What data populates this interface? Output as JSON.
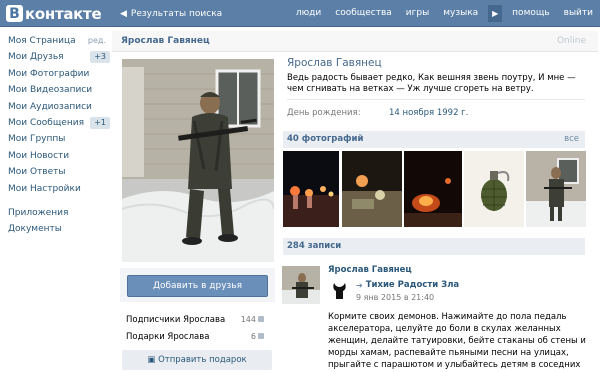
{
  "header": {
    "logo_letter": "В",
    "logo_text": "контакте",
    "back_label": "Результаты поиска",
    "nav": [
      "люди",
      "сообщества",
      "игры",
      "музыка",
      "помощь",
      "выйти"
    ]
  },
  "menu": {
    "items": [
      {
        "label": "Моя Страница",
        "extra": "ред."
      },
      {
        "label": "Мои Друзья",
        "badge": "+3"
      },
      {
        "label": "Мои Фотографии"
      },
      {
        "label": "Мои Видеозаписи"
      },
      {
        "label": "Мои Аудиозаписи"
      },
      {
        "label": "Мои Сообщения",
        "badge": "+1"
      },
      {
        "label": "Мои Группы"
      },
      {
        "label": "Мои Новости"
      },
      {
        "label": "Мои Ответы"
      },
      {
        "label": "Мои Настройки"
      }
    ],
    "secondary": [
      "Приложения",
      "Документы"
    ]
  },
  "profile": {
    "bar_name": "Ярослав Гавянец",
    "online": "Online",
    "name": "Ярослав Гавянец",
    "status": "Ведь радость бывает редко, Как вешняя звень поутру, И мне — чем сгнивать на ветках — Уж лучше сгореть на ветру.",
    "bday_label": "День рождения:",
    "bday_value": "14 ноября 1992 г.",
    "add_friend": "Добавить в друзья",
    "subscribers_label": "Подписчики Ярослава",
    "subscribers_count": "144",
    "gifts_label": "Подарки Ярослава",
    "gifts_count": "6",
    "send_gift": "Отправить подарок"
  },
  "photos": {
    "title": "40 фотографий",
    "all": "все"
  },
  "wall": {
    "title": "284 записи",
    "author": "Ярослав Гавянец",
    "group": "Тихие Радости Зла",
    "date": "9 янв 2015 в 21:40",
    "text": "Кормите своих демонов. Нажимайте до пола педаль акселератора, целуйте до боли в скулах желанных женщин, делайте татуировки, бейте стаканы об стены и морды хамам, распевайте пьяными песни на улицах, прыгайте с парашютом и улыбайтесь детям в соседних машинах через стекло"
  },
  "colors": {
    "header_bg": "#5b7fa6",
    "link": "#2b587a",
    "accent_button": "#6a8fb9"
  }
}
